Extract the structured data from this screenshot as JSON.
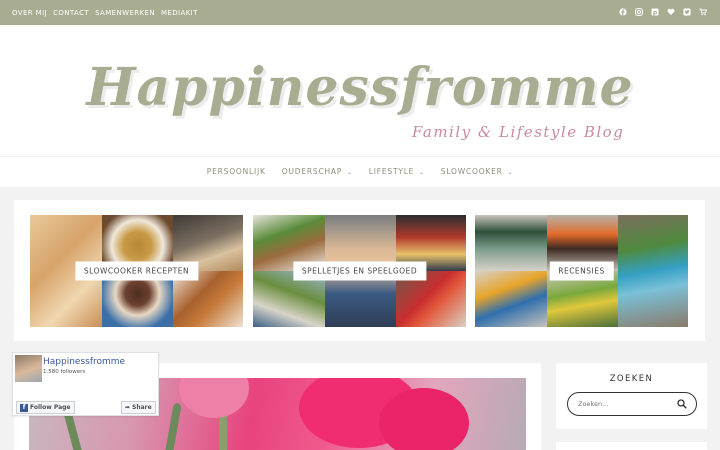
{
  "topbar": {
    "links": [
      "OVER MIJ",
      "CONTACT",
      "SAMENWERKEN",
      "MEDIAKIT"
    ],
    "social_icons": [
      "facebook-icon",
      "instagram-icon",
      "pinterest-icon",
      "heart-icon",
      "twitter-icon",
      "shopping-cart-icon"
    ]
  },
  "header": {
    "title": "Happinessfromme",
    "tagline": "Family & Lifestyle Blog"
  },
  "nav": {
    "items": [
      {
        "label": "PERSOONLIJK",
        "dropdown": false
      },
      {
        "label": "OUDERSCHAP",
        "dropdown": true
      },
      {
        "label": "LIFESTYLE",
        "dropdown": true
      },
      {
        "label": "SLOWCOOKER",
        "dropdown": true
      }
    ]
  },
  "featured": [
    {
      "label": "SLOWCOOKER RECEPTEN"
    },
    {
      "label": "SPELLETJES EN SPEELGOED"
    },
    {
      "label": "RECENSIES"
    }
  ],
  "facebook": {
    "page_name": "Happinessfromme",
    "followers": "1.580 followers",
    "follow_label": "Follow Page",
    "share_label": "Share"
  },
  "sidebar": {
    "search_title": "ZOEKEN",
    "search_placeholder": "Zoeken..."
  },
  "colors": {
    "topbar": "#a8ad92",
    "logo": "#a8ad92",
    "tagline": "#c98aa0",
    "nav_text": "#8a8f78",
    "facebook_link": "#3b5998"
  }
}
